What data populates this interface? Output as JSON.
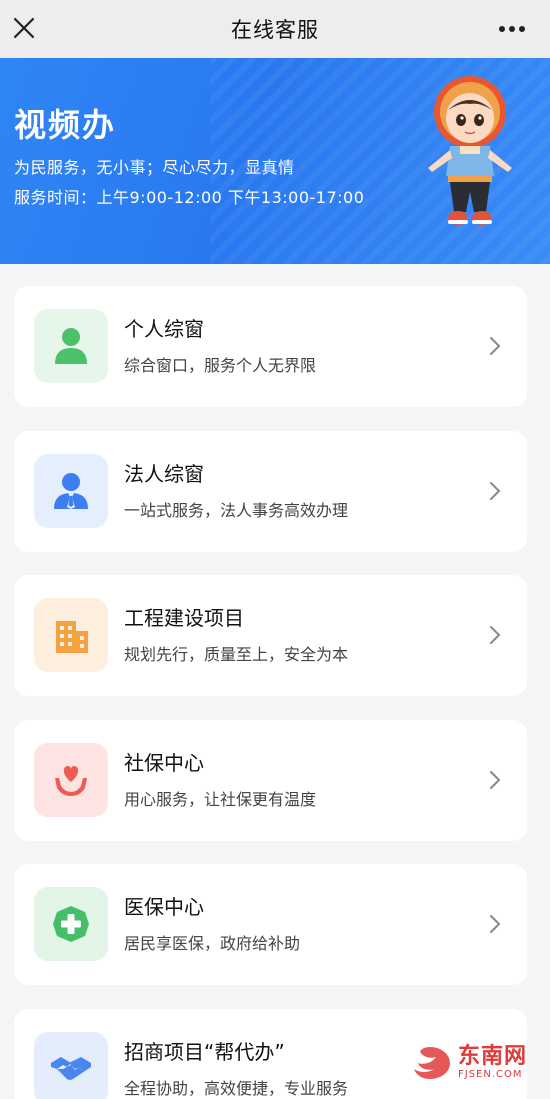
{
  "header": {
    "title": "在线客服"
  },
  "banner": {
    "title": "视频办",
    "slogan": "为民服务，无小事；尽心尽力，显真情",
    "hours": "服务时间：上午9:00-12:00 下午13:00-17:00"
  },
  "cards": [
    {
      "title": "个人综窗",
      "subtitle": "综合窗口，服务个人无界限",
      "icon": "person-icon",
      "icon_color": "#4cc16b",
      "bg": "#e6f6ea"
    },
    {
      "title": "法人综窗",
      "subtitle": "一站式服务，法人事务高效办理",
      "icon": "business-person-icon",
      "icon_color": "#3d7ff2",
      "bg": "#e4eefc"
    },
    {
      "title": "工程建设项目",
      "subtitle": "规划先行，质量至上，安全为本",
      "icon": "building-icon",
      "icon_color": "#f4a340",
      "bg": "#fdeedd"
    },
    {
      "title": "社保中心",
      "subtitle": "用心服务，让社保更有温度",
      "icon": "heart-hands-icon",
      "icon_color": "#f05a50",
      "bg": "#fde3e2"
    },
    {
      "title": "医保中心",
      "subtitle": "居民享医保，政府给补助",
      "icon": "medical-cross-icon",
      "icon_color": "#43bf67",
      "bg": "#e2f5e7"
    },
    {
      "title": "招商项目“帮代办”",
      "subtitle": "全程协助，高效便捷，专业服务",
      "icon": "handshake-icon",
      "icon_color": "#4a86f0",
      "bg": "#e4edfc"
    }
  ],
  "watermark": {
    "cn": "东南网",
    "en": "FJSEN.COM"
  }
}
